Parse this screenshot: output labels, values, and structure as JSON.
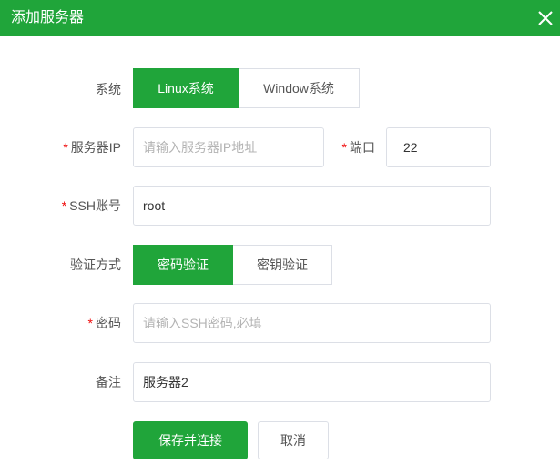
{
  "dialog": {
    "title": "添加服务器",
    "close_icon": "close-icon"
  },
  "form": {
    "system": {
      "label": "系统",
      "options": [
        "Linux系统",
        "Window系统"
      ],
      "selected": "Linux系统"
    },
    "server_ip": {
      "required_mark": "*",
      "label": "服务器IP",
      "placeholder": "请输入服务器IP地址",
      "value": ""
    },
    "port": {
      "required_mark": "*",
      "label": "端口",
      "value": "22"
    },
    "ssh_account": {
      "required_mark": "*",
      "label": "SSH账号",
      "value": "root"
    },
    "auth_method": {
      "label": "验证方式",
      "options": [
        "密码验证",
        "密钥验证"
      ],
      "selected": "密码验证"
    },
    "password": {
      "required_mark": "*",
      "label": "密码",
      "placeholder": "请输入SSH密码,必填",
      "value": ""
    },
    "remark": {
      "label": "备注",
      "value": "服务器2"
    }
  },
  "actions": {
    "save_label": "保存并连接",
    "cancel_label": "取消"
  },
  "colors": {
    "accent": "#20a53a",
    "required": "#ef0808",
    "border": "#dcdfe6",
    "placeholder": "#b4b4b4"
  }
}
